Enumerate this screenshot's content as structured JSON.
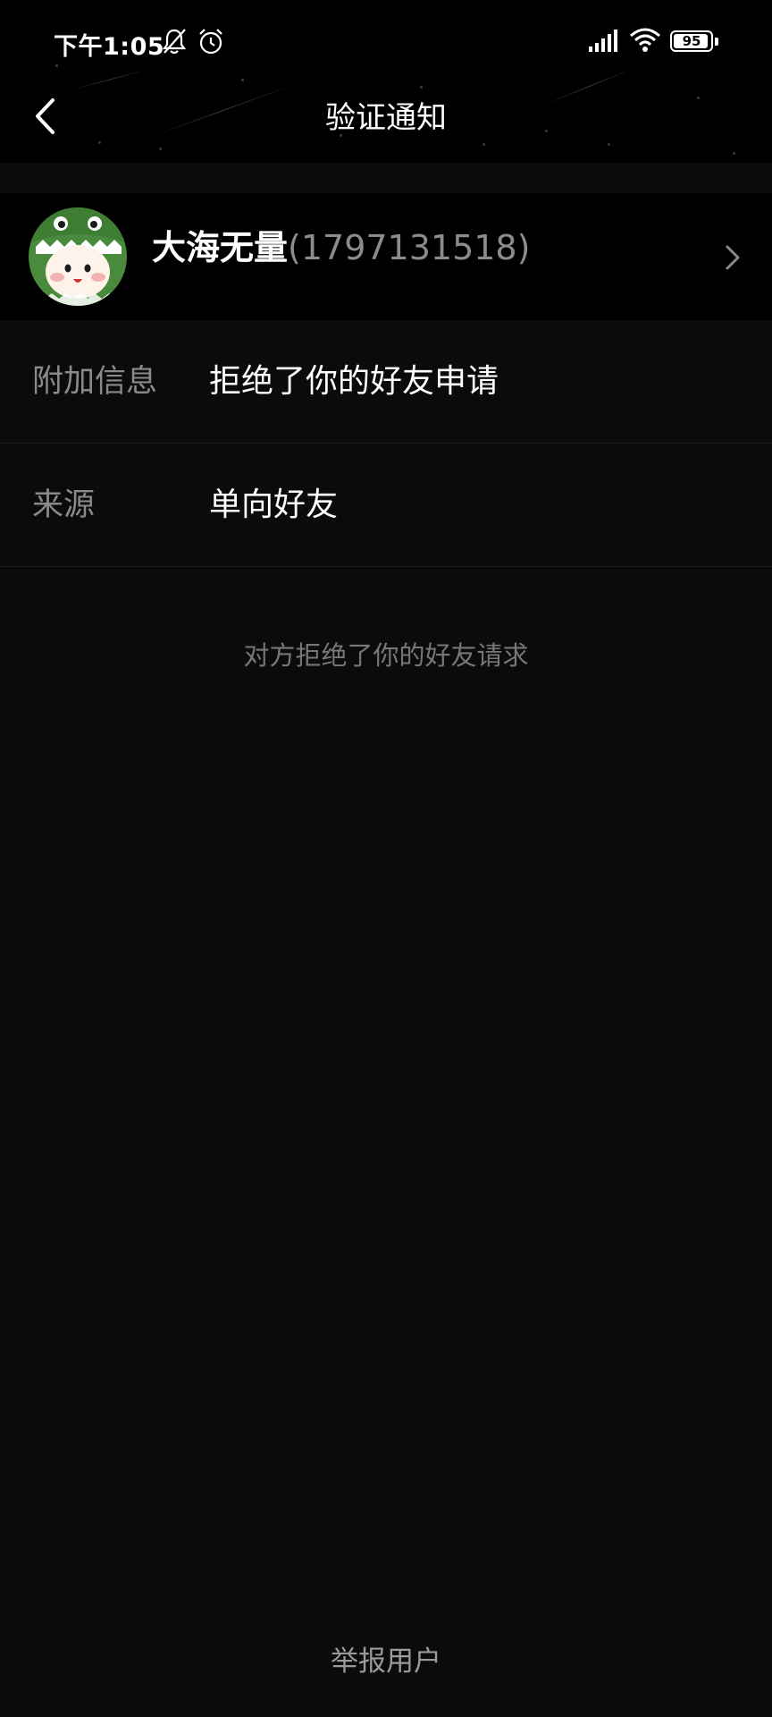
{
  "status_bar": {
    "time": "下午1:05",
    "battery_level": "95",
    "icons": [
      "mute-bell-icon",
      "alarm-icon",
      "signal-icon",
      "wifi-icon",
      "battery-icon"
    ]
  },
  "nav": {
    "title": "验证通知",
    "back_icon": "chevron-left-icon"
  },
  "profile": {
    "name": "大海无量",
    "id_text": "(1797131518)",
    "chevron_icon": "chevron-right-icon"
  },
  "info_rows": [
    {
      "label": "附加信息",
      "value": "拒绝了你的好友申请"
    },
    {
      "label": "来源",
      "value": "单向好友"
    }
  ],
  "notice": "对方拒绝了你的好友请求",
  "footer": {
    "report_label": "举报用户"
  },
  "colors": {
    "background": "#0b0b0b",
    "header_background": "#000000",
    "label_gray": "#8a8a8a",
    "notice_gray": "#777777",
    "avatar_green": "#4a8a3c"
  }
}
